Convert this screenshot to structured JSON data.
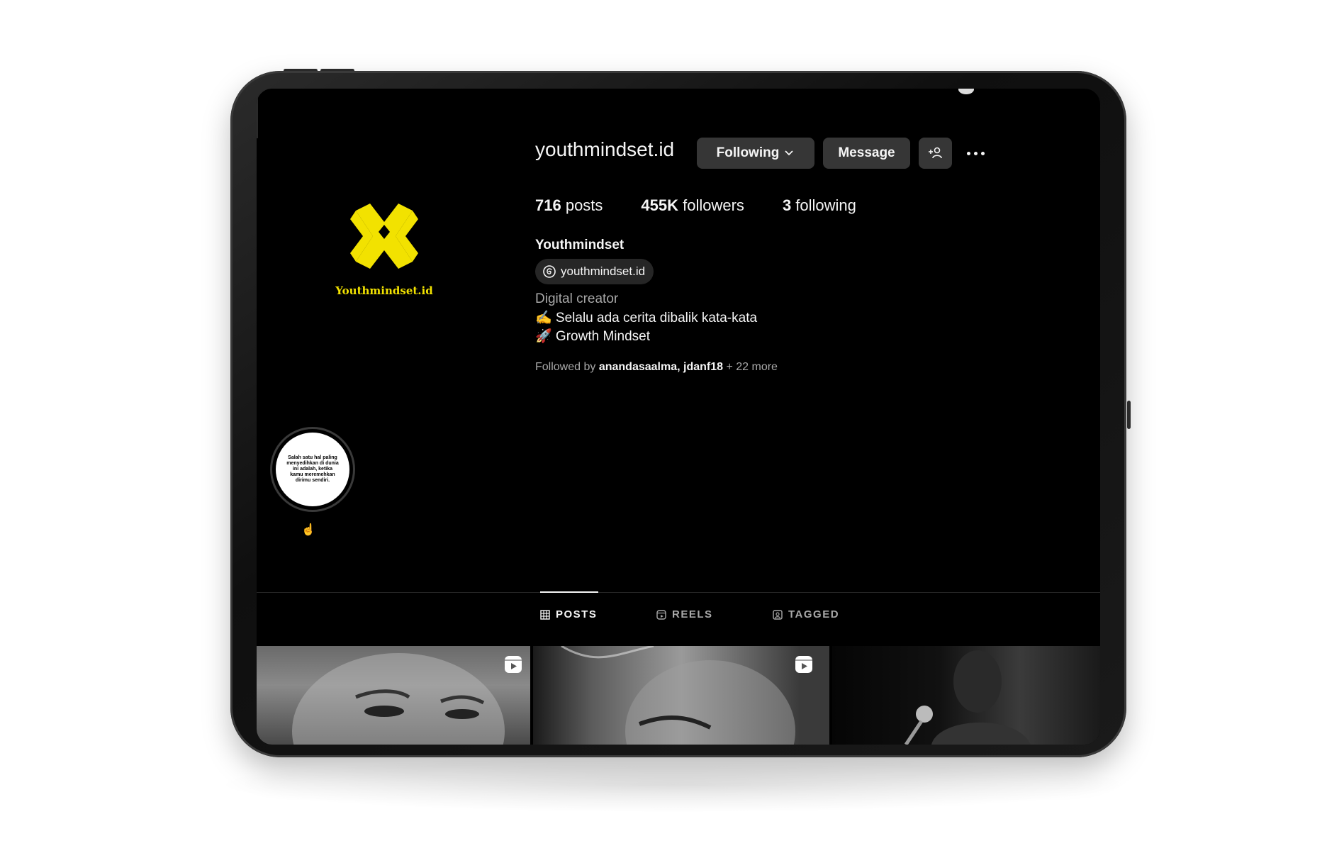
{
  "profile": {
    "username": "youthmindset.id",
    "avatar_text": "Youthmindset.id",
    "display_name": "Youthmindset",
    "threads_handle": "youthmindset.id",
    "category": "Digital creator",
    "bio_line1": "✍️ Selalu ada cerita dibalik kata-kata",
    "bio_line2": "🚀 Growth Mindset",
    "followed_prefix": "Followed by ",
    "followed_user1": "anandasaalma",
    "followed_sep": ", ",
    "followed_user2": "jdanf18",
    "followed_suffix": " + 22 more"
  },
  "actions": {
    "following_label": "Following",
    "message_label": "Message"
  },
  "stats": {
    "posts_count": "716",
    "posts_label": " posts",
    "followers_count": "455K",
    "followers_label": " followers",
    "following_count": "3",
    "following_label": " following"
  },
  "highlight": {
    "text": "Salah satu hal paling menyedihkan di dunia ini adalah, ketika kamu meremehkan dirimu sendiri.",
    "label": "☝️"
  },
  "tabs": {
    "posts": "POSTS",
    "reels": "REELS",
    "tagged": "TAGGED"
  },
  "colors": {
    "background": "#000000",
    "button": "#363636",
    "logo_yellow": "#f2e200",
    "muted_text": "#a8a8a8"
  }
}
